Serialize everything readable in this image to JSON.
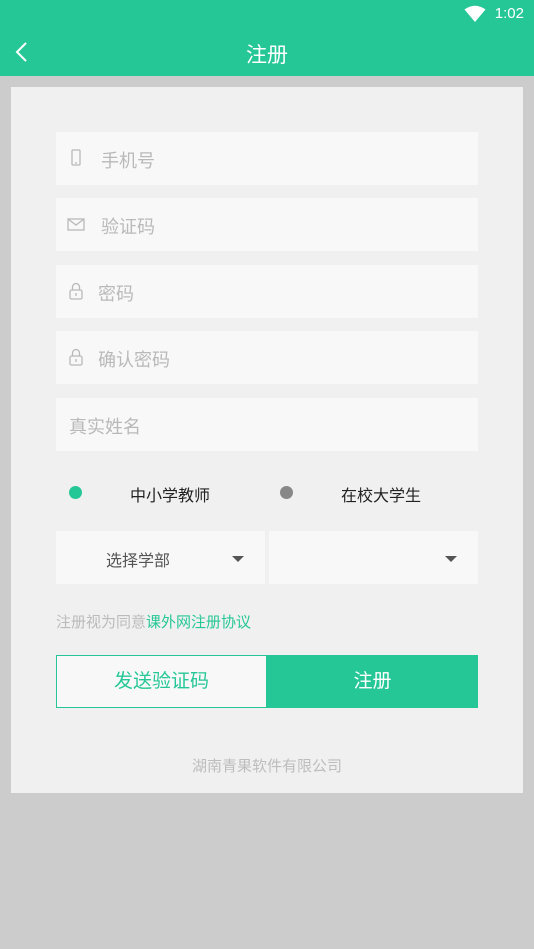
{
  "status_bar": {
    "time": "1:02",
    "wifi_icon": "wifi-icon"
  },
  "header": {
    "title": "注册",
    "back_icon": "chevron-left-icon"
  },
  "form": {
    "phone": {
      "placeholder": "手机号",
      "icon": "phone-icon"
    },
    "code": {
      "placeholder": "验证码",
      "icon": "envelope-icon"
    },
    "password": {
      "placeholder": "密码",
      "icon": "lock-icon"
    },
    "confirm_password": {
      "placeholder": "确认密码",
      "icon": "lock-icon"
    },
    "real_name": {
      "placeholder": "真实姓名"
    }
  },
  "role_options": [
    {
      "label": "中小学教师",
      "selected": true
    },
    {
      "label": "在校大学生",
      "selected": false
    }
  ],
  "selects": {
    "department": {
      "value": "选择学部"
    },
    "second": {
      "value": ""
    }
  },
  "agreement": {
    "prefix": "注册视为同意",
    "link": "课外网注册协议"
  },
  "buttons": {
    "send_code": "发送验证码",
    "register": "注册"
  },
  "footer": {
    "company": "湖南青果软件有限公司"
  },
  "colors": {
    "accent": "#26c796",
    "background": "#cccccc",
    "card": "#f0f0f0",
    "unselected_dot": "#888888"
  }
}
